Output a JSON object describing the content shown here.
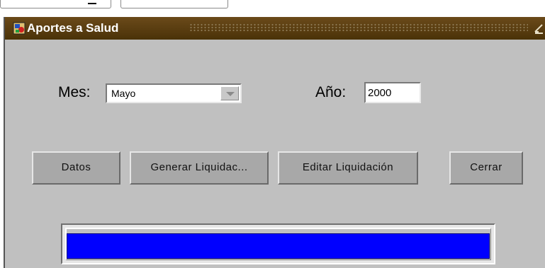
{
  "window": {
    "title": "Aportes a Salud",
    "icon": "oracle-forms-app-icon",
    "minimize_icon": "minimize-icon"
  },
  "form": {
    "mes_label": "Mes:",
    "mes_value": "Mayo",
    "ano_label": "Año:",
    "ano_value": "2000"
  },
  "buttons": {
    "datos": "Datos",
    "generar": "Generar Liquidac...",
    "editar": "Editar Liquidación",
    "cerrar": "Cerrar"
  },
  "progress": {
    "fill_fraction": 1.0,
    "color": "#0000ff"
  },
  "colors": {
    "titlebar": "#5a3e10",
    "window_bg": "#c0c0c0",
    "button_bg": "#a8a8a8"
  }
}
